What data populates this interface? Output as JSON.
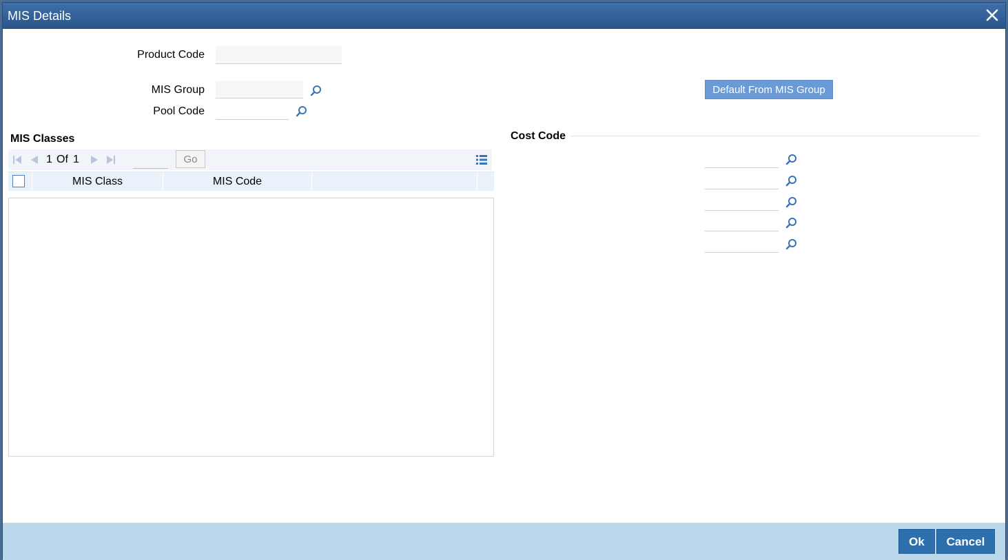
{
  "window": {
    "title": "MIS Details"
  },
  "form": {
    "product_code_label": "Product Code",
    "product_code_value": "",
    "mis_group_label": "MIS Group",
    "mis_group_value": "",
    "pool_code_label": "Pool Code",
    "pool_code_value": "",
    "default_button": "Default From MIS Group"
  },
  "mis_classes": {
    "title": "MIS Classes",
    "pagination": {
      "current": "1",
      "of_label": "Of",
      "total": "1",
      "go_label": "Go",
      "page_input": ""
    },
    "columns": [
      "MIS Class",
      "MIS Code"
    ],
    "rows": []
  },
  "cost_code": {
    "title": "Cost Code",
    "fields": [
      "",
      "",
      "",
      "",
      ""
    ]
  },
  "footer": {
    "ok_label": "Ok",
    "cancel_label": "Cancel"
  },
  "colors": {
    "title_bar": "#2a5589",
    "footer": "#bad7ec",
    "accent_button": "#2e6fae",
    "default_button": "#6b9bd6"
  }
}
